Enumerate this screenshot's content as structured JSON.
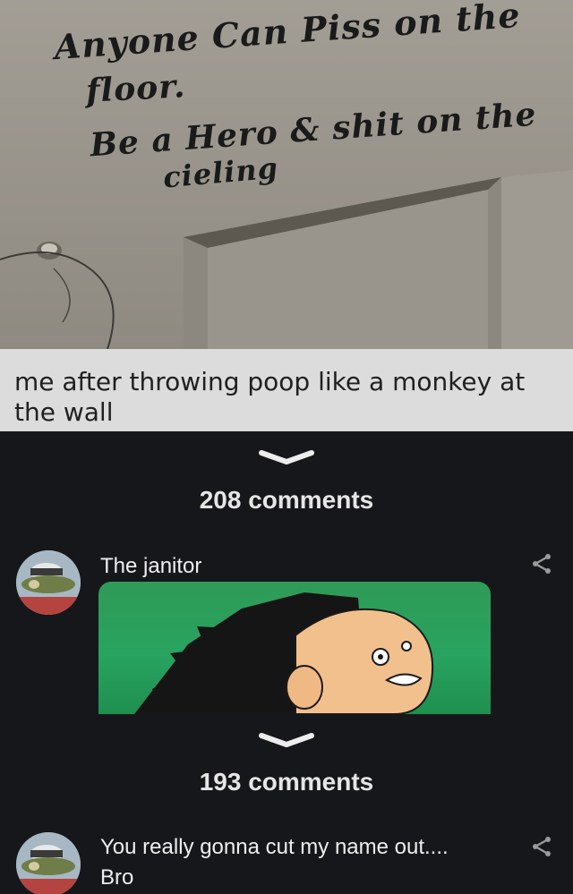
{
  "photo": {
    "handwriting_lines": [
      "Anyone Can Piss on the",
      "floor.",
      "Be a Hero & shit on the",
      "cieling"
    ]
  },
  "caption": {
    "text": "me after throwing poop like a monkey at the wall"
  },
  "threads": [
    {
      "comment_count": "208 comments",
      "comment_text": "The janitor",
      "has_image": true
    },
    {
      "comment_count": "193 comments",
      "comment_text": "You really gonna cut my name out.... Bro",
      "has_image": false
    }
  ],
  "colors": {
    "background": "#16171b",
    "caption_bg": "#dcdcdc",
    "text": "#efefef"
  },
  "icons": [
    "chevron-down-icon",
    "share-icon"
  ]
}
